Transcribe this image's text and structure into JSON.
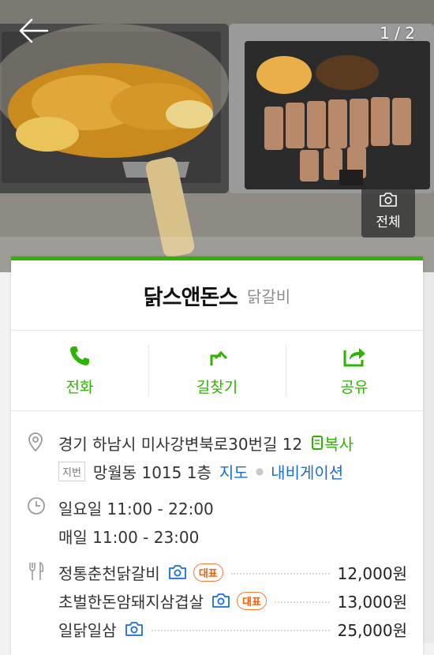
{
  "header": {
    "page_counter": "1 / 2",
    "all_photos_label": "전체"
  },
  "store": {
    "name": "닭스앤돈스",
    "category": "닭갈비"
  },
  "actions": [
    {
      "label": "전화",
      "icon": "phone-icon"
    },
    {
      "label": "길찾기",
      "icon": "directions-icon"
    },
    {
      "label": "공유",
      "icon": "share-icon"
    }
  ],
  "address": {
    "road": "경기 하남시 미사강변북로30번길 12",
    "copy_label": "복사",
    "jibun_tag": "지번",
    "jibun": "망월동 1015 1층",
    "map_link": "지도",
    "navigation_link": "내비게이션"
  },
  "hours": {
    "line1": "일요일 11:00 - 22:00",
    "line2": "매일 11:00 - 23:00"
  },
  "menu": [
    {
      "name": "정통춘천닭갈비",
      "badge": "대표",
      "price": "12,000원"
    },
    {
      "name": "초벌한돈암돼지삼겹살",
      "badge": "대표",
      "price": "13,000원"
    },
    {
      "name": "일닭일삼",
      "badge": "",
      "price": "25,000원"
    }
  ],
  "colors": {
    "accent_green": "#2db400",
    "link_blue": "#1a6dd4",
    "badge_orange": "#ff5a00"
  }
}
